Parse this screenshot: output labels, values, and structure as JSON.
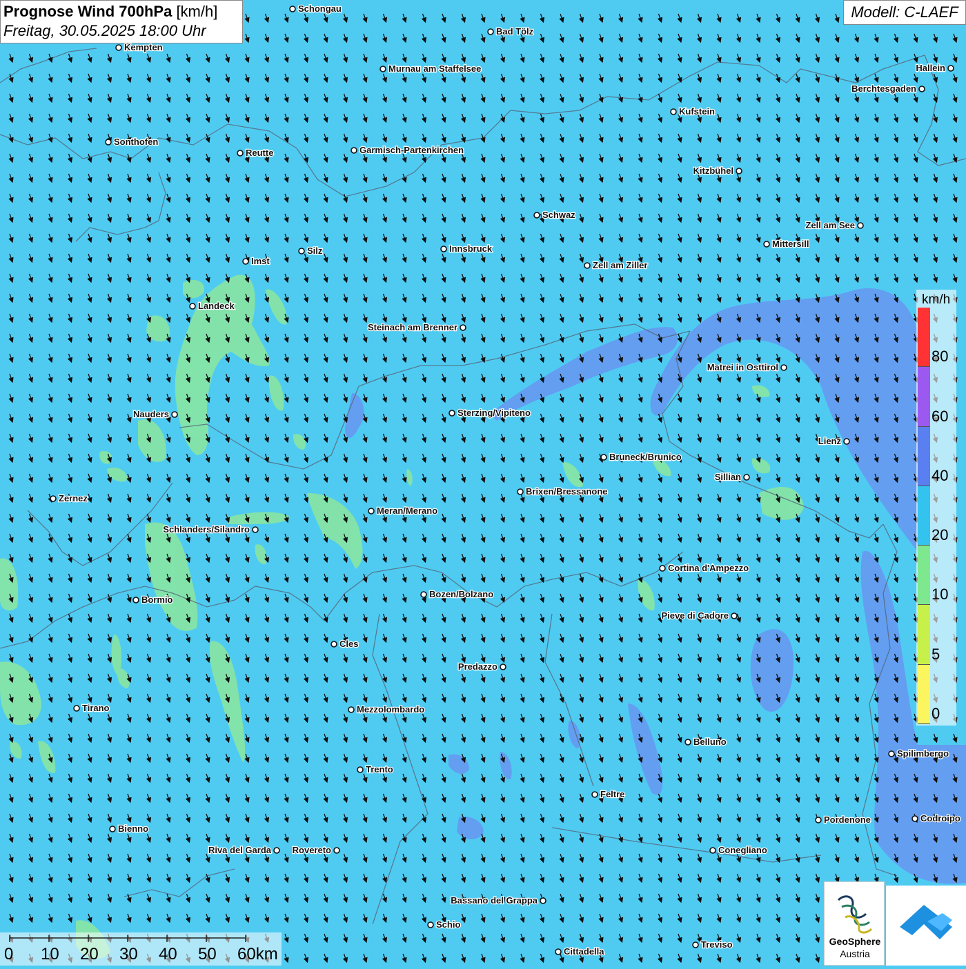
{
  "header": {
    "title_bold": "Prognose Wind 700hPa",
    "title_unit": "[km/h]",
    "subtitle": "Freitag, 30.05.2025 18:00 Uhr"
  },
  "model_label": "Modell: C-LAEF",
  "legend": {
    "unit": "km/h",
    "labels": [
      "80",
      "60",
      "40",
      "20",
      "10",
      "5",
      "0"
    ],
    "colors": [
      "#ff3333",
      "#9b59f0",
      "#5a7ff0",
      "#34c3ef",
      "#7ee88f",
      "#c7f04a",
      "#fbf560"
    ]
  },
  "scale_bar": {
    "labels": [
      "0",
      "10",
      "20",
      "30",
      "40",
      "50",
      "60km"
    ]
  },
  "logos": {
    "geosphere_line1": "GeoSphere",
    "geosphere_line2": "Austria"
  },
  "wind": {
    "direction": "from north-northwest",
    "dominant_speed_class": "20-40 km/h"
  },
  "cities": [
    {
      "name": "Schongau"
    },
    {
      "name": "Bad Tölz"
    },
    {
      "name": "Kempten"
    },
    {
      "name": "Murnau am Staffelsee"
    },
    {
      "name": "Hallein"
    },
    {
      "name": "Berchtesgaden"
    },
    {
      "name": "Kufstein"
    },
    {
      "name": "Sonthofen"
    },
    {
      "name": "Reutte"
    },
    {
      "name": "Garmisch-Partenkirchen"
    },
    {
      "name": "Kitzbühel"
    },
    {
      "name": "Schwaz"
    },
    {
      "name": "Zell am See"
    },
    {
      "name": "Mittersill"
    },
    {
      "name": "Imst"
    },
    {
      "name": "Silz"
    },
    {
      "name": "Innsbruck"
    },
    {
      "name": "Zell am Ziller"
    },
    {
      "name": "Landeck"
    },
    {
      "name": "Steinach am Brenner"
    },
    {
      "name": "Matrei in Osttirol"
    },
    {
      "name": "Nauders"
    },
    {
      "name": "Sterzing/Vipiteno"
    },
    {
      "name": "Lienz"
    },
    {
      "name": "Bruneck/Brunico"
    },
    {
      "name": "Sillian"
    },
    {
      "name": "Zernez"
    },
    {
      "name": "Brixen/Bressanone"
    },
    {
      "name": "Meran/Merano"
    },
    {
      "name": "Schlanders/Silandro"
    },
    {
      "name": "Cortina d'Ampezzo"
    },
    {
      "name": "Bozen/Bolzano"
    },
    {
      "name": "Bormio"
    },
    {
      "name": "Pieve di Cadore"
    },
    {
      "name": "Cles"
    },
    {
      "name": "Predazzo"
    },
    {
      "name": "Tirano"
    },
    {
      "name": "Mezzolombardo"
    },
    {
      "name": "Belluno"
    },
    {
      "name": "Spilimbergo"
    },
    {
      "name": "Trento"
    },
    {
      "name": "Feltre"
    },
    {
      "name": "Bienno"
    },
    {
      "name": "Pordenone"
    },
    {
      "name": "Codroipo"
    },
    {
      "name": "Riva del Garda"
    },
    {
      "name": "Rovereto"
    },
    {
      "name": "Conegliano"
    },
    {
      "name": "Bassano del Grappa"
    },
    {
      "name": "Schio"
    },
    {
      "name": "Treviso"
    },
    {
      "name": "Cittadella"
    }
  ]
}
